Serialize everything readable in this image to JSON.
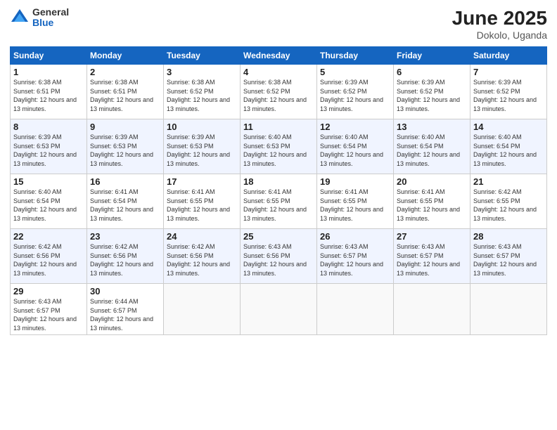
{
  "header": {
    "logo_general": "General",
    "logo_blue": "Blue",
    "month_title": "June 2025",
    "location": "Dokolo, Uganda"
  },
  "days_of_week": [
    "Sunday",
    "Monday",
    "Tuesday",
    "Wednesday",
    "Thursday",
    "Friday",
    "Saturday"
  ],
  "weeks": [
    [
      {
        "day": "1",
        "sunrise": "6:38 AM",
        "sunset": "6:51 PM",
        "daylight": "12 hours and 13 minutes."
      },
      {
        "day": "2",
        "sunrise": "6:38 AM",
        "sunset": "6:51 PM",
        "daylight": "12 hours and 13 minutes."
      },
      {
        "day": "3",
        "sunrise": "6:38 AM",
        "sunset": "6:52 PM",
        "daylight": "12 hours and 13 minutes."
      },
      {
        "day": "4",
        "sunrise": "6:38 AM",
        "sunset": "6:52 PM",
        "daylight": "12 hours and 13 minutes."
      },
      {
        "day": "5",
        "sunrise": "6:39 AM",
        "sunset": "6:52 PM",
        "daylight": "12 hours and 13 minutes."
      },
      {
        "day": "6",
        "sunrise": "6:39 AM",
        "sunset": "6:52 PM",
        "daylight": "12 hours and 13 minutes."
      },
      {
        "day": "7",
        "sunrise": "6:39 AM",
        "sunset": "6:52 PM",
        "daylight": "12 hours and 13 minutes."
      }
    ],
    [
      {
        "day": "8",
        "sunrise": "6:39 AM",
        "sunset": "6:53 PM",
        "daylight": "12 hours and 13 minutes."
      },
      {
        "day": "9",
        "sunrise": "6:39 AM",
        "sunset": "6:53 PM",
        "daylight": "12 hours and 13 minutes."
      },
      {
        "day": "10",
        "sunrise": "6:39 AM",
        "sunset": "6:53 PM",
        "daylight": "12 hours and 13 minutes."
      },
      {
        "day": "11",
        "sunrise": "6:40 AM",
        "sunset": "6:53 PM",
        "daylight": "12 hours and 13 minutes."
      },
      {
        "day": "12",
        "sunrise": "6:40 AM",
        "sunset": "6:54 PM",
        "daylight": "12 hours and 13 minutes."
      },
      {
        "day": "13",
        "sunrise": "6:40 AM",
        "sunset": "6:54 PM",
        "daylight": "12 hours and 13 minutes."
      },
      {
        "day": "14",
        "sunrise": "6:40 AM",
        "sunset": "6:54 PM",
        "daylight": "12 hours and 13 minutes."
      }
    ],
    [
      {
        "day": "15",
        "sunrise": "6:40 AM",
        "sunset": "6:54 PM",
        "daylight": "12 hours and 13 minutes."
      },
      {
        "day": "16",
        "sunrise": "6:41 AM",
        "sunset": "6:54 PM",
        "daylight": "12 hours and 13 minutes."
      },
      {
        "day": "17",
        "sunrise": "6:41 AM",
        "sunset": "6:55 PM",
        "daylight": "12 hours and 13 minutes."
      },
      {
        "day": "18",
        "sunrise": "6:41 AM",
        "sunset": "6:55 PM",
        "daylight": "12 hours and 13 minutes."
      },
      {
        "day": "19",
        "sunrise": "6:41 AM",
        "sunset": "6:55 PM",
        "daylight": "12 hours and 13 minutes."
      },
      {
        "day": "20",
        "sunrise": "6:41 AM",
        "sunset": "6:55 PM",
        "daylight": "12 hours and 13 minutes."
      },
      {
        "day": "21",
        "sunrise": "6:42 AM",
        "sunset": "6:55 PM",
        "daylight": "12 hours and 13 minutes."
      }
    ],
    [
      {
        "day": "22",
        "sunrise": "6:42 AM",
        "sunset": "6:56 PM",
        "daylight": "12 hours and 13 minutes."
      },
      {
        "day": "23",
        "sunrise": "6:42 AM",
        "sunset": "6:56 PM",
        "daylight": "12 hours and 13 minutes."
      },
      {
        "day": "24",
        "sunrise": "6:42 AM",
        "sunset": "6:56 PM",
        "daylight": "12 hours and 13 minutes."
      },
      {
        "day": "25",
        "sunrise": "6:43 AM",
        "sunset": "6:56 PM",
        "daylight": "12 hours and 13 minutes."
      },
      {
        "day": "26",
        "sunrise": "6:43 AM",
        "sunset": "6:57 PM",
        "daylight": "12 hours and 13 minutes."
      },
      {
        "day": "27",
        "sunrise": "6:43 AM",
        "sunset": "6:57 PM",
        "daylight": "12 hours and 13 minutes."
      },
      {
        "day": "28",
        "sunrise": "6:43 AM",
        "sunset": "6:57 PM",
        "daylight": "12 hours and 13 minutes."
      }
    ],
    [
      {
        "day": "29",
        "sunrise": "6:43 AM",
        "sunset": "6:57 PM",
        "daylight": "12 hours and 13 minutes."
      },
      {
        "day": "30",
        "sunrise": "6:44 AM",
        "sunset": "6:57 PM",
        "daylight": "12 hours and 13 minutes."
      },
      null,
      null,
      null,
      null,
      null
    ]
  ]
}
